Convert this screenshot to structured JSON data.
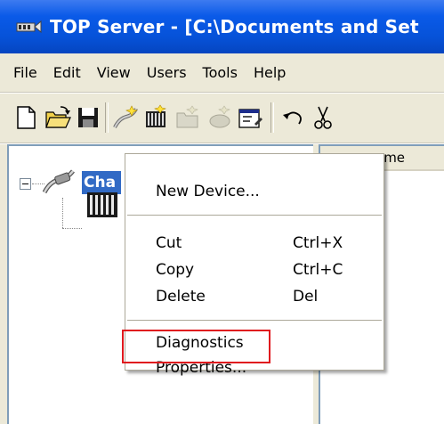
{
  "window": {
    "title": "TOP Server - [C:\\Documents and Set",
    "app_icon": "top-server-icon"
  },
  "menubar": {
    "items": [
      "File",
      "Edit",
      "View",
      "Users",
      "Tools",
      "Help"
    ]
  },
  "toolbar": {
    "buttons": [
      "new-icon",
      "open-icon",
      "save-icon",
      "new-channel-icon",
      "new-device-icon",
      "new-group-icon",
      "new-tag-icon",
      "properties-icon",
      "undo-icon",
      "cut-icon"
    ]
  },
  "tree": {
    "channel_label": "Cha",
    "channel_icon": "channel-icon",
    "device_icon": "device-icon"
  },
  "list": {
    "header": "ame"
  },
  "context_menu": {
    "items": [
      {
        "label": "New Device...",
        "shortcut": ""
      },
      {
        "label": "Cut",
        "shortcut": "Ctrl+X"
      },
      {
        "label": "Copy",
        "shortcut": "Ctrl+C"
      },
      {
        "label": "Delete",
        "shortcut": "Del"
      },
      {
        "label": "Diagnostics",
        "shortcut": ""
      },
      {
        "label": "Properties...",
        "shortcut": ""
      }
    ]
  },
  "colors": {
    "title_bar": "#0652d8",
    "selection": "#316ac5",
    "highlight_box": "#e0191e",
    "chrome": "#ece9d8"
  }
}
